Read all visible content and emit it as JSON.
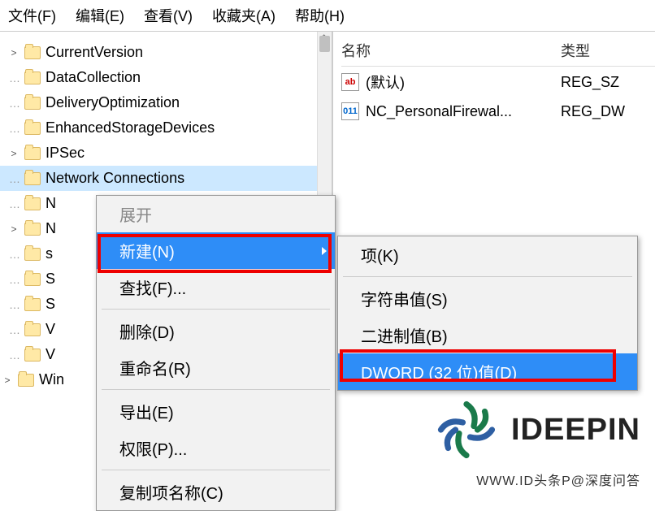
{
  "menubar": {
    "file": "文件(F)",
    "edit": "编辑(E)",
    "view": "查看(V)",
    "favorites": "收藏夹(A)",
    "help": "帮助(H)"
  },
  "tree": {
    "items": [
      {
        "label": "CurrentVersion",
        "expander": ">"
      },
      {
        "label": "DataCollection",
        "expander": "…"
      },
      {
        "label": "DeliveryOptimization",
        "expander": "…"
      },
      {
        "label": "EnhancedStorageDevices",
        "expander": "…"
      },
      {
        "label": "IPSec",
        "expander": ">"
      },
      {
        "label": "Network Connections",
        "expander": "…",
        "selected": true
      },
      {
        "label": "N",
        "expander": "…"
      },
      {
        "label": "N",
        "expander": ">"
      },
      {
        "label": "s",
        "expander": "…"
      },
      {
        "label": "S",
        "expander": "…"
      },
      {
        "label": "S",
        "expander": "…"
      },
      {
        "label": "V",
        "expander": "…"
      },
      {
        "label": "V",
        "expander": "…"
      },
      {
        "label": "Win",
        "expander": ">",
        "root": true
      }
    ]
  },
  "list": {
    "header": {
      "name": "名称",
      "type": "类型"
    },
    "rows": [
      {
        "icon": "ab",
        "name": "(默认)",
        "type": "REG_SZ"
      },
      {
        "icon": "011",
        "name": "NC_PersonalFirewal...",
        "type": "REG_DW"
      }
    ]
  },
  "ctx1": {
    "expand": "展开",
    "new": "新建(N)",
    "find": "查找(F)...",
    "delete": "删除(D)",
    "rename": "重命名(R)",
    "export": "导出(E)",
    "permissions": "权限(P)...",
    "copyKeyName": "复制项名称(C)"
  },
  "ctx2": {
    "key": "项(K)",
    "string": "字符串值(S)",
    "binary": "二进制值(B)",
    "dword": "DWORD (32 位)值(D)"
  },
  "watermark": {
    "brand": "IDEEPIN",
    "site": "WWW.ID头条P@深度问答"
  }
}
